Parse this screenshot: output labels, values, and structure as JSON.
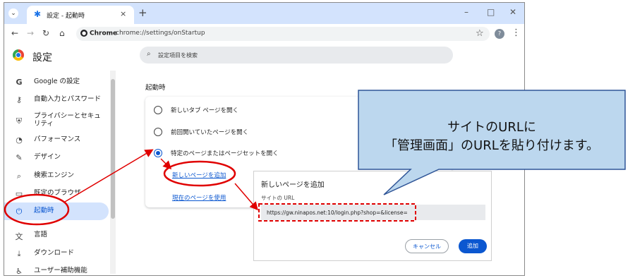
{
  "browser": {
    "tab_title": "設定 - 起動時",
    "tab_close": "×",
    "new_tab": "+",
    "tab_search_icon": "chevron-down-icon",
    "window_controls": [
      "–",
      "□",
      "✕"
    ],
    "nav_icons": [
      "←",
      "→",
      "↻",
      "⌂"
    ],
    "chip_label": "Chrome",
    "url": "chrome://settings/onStartup",
    "star": "☆",
    "avatar_letter": "?",
    "menu": "⋮"
  },
  "settings": {
    "title": "設定",
    "search_placeholder": "設定項目を検索",
    "search_icon": "⌕"
  },
  "sidebar": {
    "items": [
      {
        "icon": "G",
        "label": "Google の設定"
      },
      {
        "icon": "⚷",
        "label": "自動入力とパスワード"
      },
      {
        "icon": "⛨",
        "label": "プライバシーとセキュリティ"
      },
      {
        "icon": "◔",
        "label": "パフォーマンス"
      },
      {
        "icon": "✎",
        "label": "デザイン"
      },
      {
        "icon": "⌕",
        "label": "検索エンジン"
      },
      {
        "icon": "▭",
        "label": "既定のブラウザ"
      },
      {
        "icon": "⏻",
        "label": "起動時"
      },
      {
        "icon": "文",
        "label": "言語"
      },
      {
        "icon": "⤓",
        "label": "ダウンロード"
      },
      {
        "icon": "♿",
        "label": "ユーザー補助機能"
      }
    ]
  },
  "startup": {
    "section_title": "起動時",
    "options": [
      "新しいタブ ページを開く",
      "前回開いていたページを開く",
      "特定のページまたはページセットを開く"
    ],
    "add_page_link": "新しいページを追加",
    "use_current_link": "現在のページを使用"
  },
  "dialog": {
    "title": "新しいページを追加",
    "url_label": "サイトの URL",
    "url_value": "https://gw.ninapos.net:10/login.php?shop=&license=",
    "cancel_label": "キャンセル",
    "add_label": "追加"
  },
  "annotation": {
    "line1": "サイトのURLに",
    "line2": "「管理画面」のURLを貼り付けます。"
  },
  "colors": {
    "accent": "#0b57d0",
    "annotation_red": "#e00000",
    "callout_fill": "#bcd7ee",
    "callout_border": "#2f5597"
  }
}
